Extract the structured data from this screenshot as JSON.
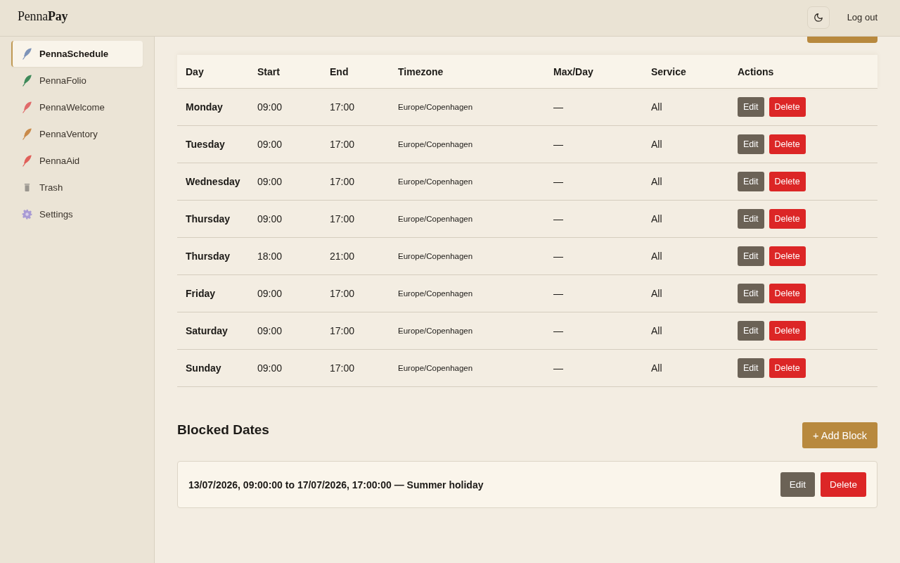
{
  "header": {
    "logo": "Penna**Pay**",
    "logout": "Log out"
  },
  "sidebar": {
    "items": [
      {
        "label": "PennaSchedule",
        "kind": "feather",
        "color": "#7d93b8",
        "selected": true
      },
      {
        "label": "PennaFolio",
        "kind": "feather",
        "color": "#3f8a5a",
        "selected": false
      },
      {
        "label": "PennaWelcome",
        "kind": "feather",
        "color": "#e06a6a",
        "selected": false
      },
      {
        "label": "PennaVentory",
        "kind": "feather",
        "color": "#c98a4a",
        "selected": false
      },
      {
        "label": "PennaAid",
        "kind": "feather",
        "color": "#e0605a",
        "selected": false
      },
      {
        "label": "Trash",
        "kind": "trash",
        "color": "#9a968f",
        "selected": false
      },
      {
        "label": "Settings",
        "kind": "gear",
        "color": "#a99bd4",
        "selected": false
      }
    ]
  },
  "main": {
    "top_button_cut_off": true
  },
  "schedule": {
    "columns": [
      "Day",
      "Start",
      "End",
      "Timezone",
      "Max/Day",
      "Service",
      "Actions"
    ],
    "rows": [
      {
        "day": "Monday",
        "start": "09:00",
        "end": "17:00",
        "timezone": "Europe/Copenhagen",
        "max_per_day": "—",
        "service": "All",
        "actions": [
          {
            "label": "Edit",
            "kind": "edit"
          },
          {
            "label": "Delete",
            "kind": "delete"
          }
        ]
      },
      {
        "day": "Tuesday",
        "start": "09:00",
        "end": "17:00",
        "timezone": "Europe/Copenhagen",
        "max_per_day": "—",
        "service": "All",
        "actions": [
          {
            "label": "Edit",
            "kind": "edit"
          },
          {
            "label": "Delete",
            "kind": "delete"
          }
        ]
      },
      {
        "day": "Wednesday",
        "start": "09:00",
        "end": "17:00",
        "timezone": "Europe/Copenhagen",
        "max_per_day": "—",
        "service": "All",
        "actions": [
          {
            "label": "Edit",
            "kind": "edit"
          },
          {
            "label": "Delete",
            "kind": "delete"
          }
        ]
      },
      {
        "day": "Thursday",
        "start": "09:00",
        "end": "17:00",
        "timezone": "Europe/Copenhagen",
        "max_per_day": "—",
        "service": "All",
        "actions": [
          {
            "label": "Edit",
            "kind": "edit"
          },
          {
            "label": "Delete",
            "kind": "delete"
          }
        ]
      },
      {
        "day": "Thursday",
        "start": "18:00",
        "end": "21:00",
        "timezone": "Europe/Copenhagen",
        "max_per_day": "—",
        "service": "All",
        "actions": [
          {
            "label": "Edit",
            "kind": "edit"
          },
          {
            "label": "Delete",
            "kind": "delete"
          }
        ]
      },
      {
        "day": "Friday",
        "start": "09:00",
        "end": "17:00",
        "timezone": "Europe/Copenhagen",
        "max_per_day": "—",
        "service": "All",
        "actions": [
          {
            "label": "Edit",
            "kind": "edit"
          },
          {
            "label": "Delete",
            "kind": "delete"
          }
        ]
      },
      {
        "day": "Saturday",
        "start": "09:00",
        "end": "17:00",
        "timezone": "Europe/Copenhagen",
        "max_per_day": "—",
        "service": "All",
        "actions": [
          {
            "label": "Edit",
            "kind": "edit"
          },
          {
            "label": "Delete",
            "kind": "delete"
          }
        ]
      },
      {
        "day": "Sunday",
        "start": "09:00",
        "end": "17:00",
        "timezone": "Europe/Copenhagen",
        "max_per_day": "—",
        "service": "All",
        "actions": [
          {
            "label": "Edit",
            "kind": "edit"
          },
          {
            "label": "Delete",
            "kind": "delete"
          }
        ]
      }
    ]
  },
  "blocked": {
    "title": "Blocked Dates",
    "add_button": "+ Add Block",
    "items": [
      {
        "text": "13/07/2026, 09:00:00 to 17/07/2026, 17:00:00 — Summer holiday",
        "actions": [
          {
            "label": "Edit",
            "kind": "edit"
          },
          {
            "label": "Delete",
            "kind": "delete"
          }
        ]
      }
    ]
  }
}
